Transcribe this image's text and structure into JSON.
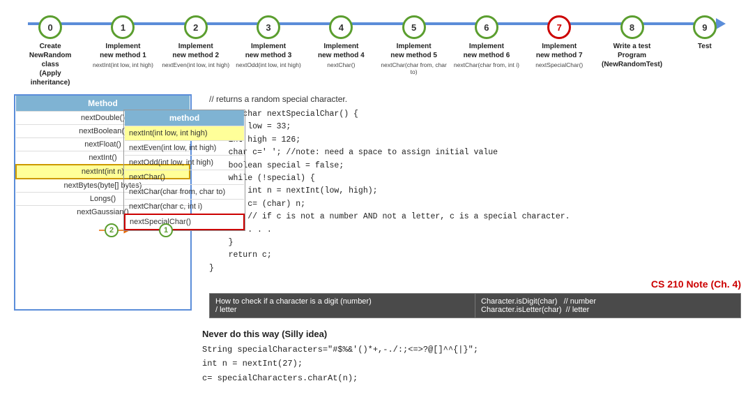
{
  "timeline": {
    "steps": [
      {
        "id": 0,
        "label": "Create\nNewRandom\nclass\n(Apply\ninheritance)",
        "sub": "",
        "border": "green"
      },
      {
        "id": 1,
        "label": "Implement\nnew method 1",
        "sub": "nextInt(int low, int high)",
        "border": "green"
      },
      {
        "id": 2,
        "label": "Implement\nnew method 2",
        "sub": "nextEven(int low, int high)",
        "border": "green"
      },
      {
        "id": 3,
        "label": "Implement\nnew method 3",
        "sub": "nextOdd(int low, int high)",
        "border": "green"
      },
      {
        "id": 4,
        "label": "Implement\nnew method 4",
        "sub": "nextChar()",
        "border": "green"
      },
      {
        "id": 5,
        "label": "Implement\nnew method 5",
        "sub": "nextChar(char from, char to)",
        "border": "green"
      },
      {
        "id": 6,
        "label": "Implement\nnew method 6",
        "sub": "nextChar(char from, int i)",
        "border": "green"
      },
      {
        "id": 7,
        "label": "Implement\nnew method 7",
        "sub": "nextSpecialChar()",
        "border": "red"
      },
      {
        "id": 8,
        "label": "Write a test\nProgram\n(NewRandomTest)",
        "sub": "",
        "border": "green"
      },
      {
        "id": 9,
        "label": "Test",
        "sub": "",
        "border": "green"
      }
    ]
  },
  "class_diagram": {
    "title": "Method",
    "methods": [
      "nextDouble()",
      "nextBoolean()",
      "nextFloat()",
      "nextInt()",
      "nextInt(int n)",
      "nextBytes(byte[] bytes)",
      "Longs()",
      "nextGaussian()"
    ]
  },
  "method_table": {
    "title": "method",
    "methods": [
      {
        "name": "nextInt(int low, int high)",
        "highlight": "yellow"
      },
      {
        "name": "nextEven(int low, int high)",
        "highlight": ""
      },
      {
        "name": "nextOdd(int low, int high)",
        "highlight": ""
      },
      {
        "name": "nextChar()",
        "highlight": ""
      },
      {
        "name": "nextChar(char from, char to)",
        "highlight": ""
      },
      {
        "name": "nextChar(char c, int i)",
        "highlight": ""
      },
      {
        "name": "nextSpecialChar()",
        "highlight": "red"
      }
    ]
  },
  "code": {
    "comment": "// returns a random special character.",
    "body": "public char nextSpecialChar() {\n    int low = 33;\n    int high = 126;\n    char c=' '; //note: need a space to assign initial value\n    boolean special = false;\n    while (!special) {\n        int n = nextInt(low, high);\n        c= (char) n;\n        // if c is not a number AND not a letter, c is a special character.\n        . . .\n    }\n    return c;\n}",
    "cs_note": "CS 210 Note (Ch. 4)",
    "info_table": [
      {
        "col1": "How to check if a character is a digit (number)\n/ letter",
        "col2": "Character.isDigit(char)  // number\nCharacter.isLetter(char)  // letter"
      }
    ]
  },
  "bottom": {
    "title": "Never do this way (Silly idea)",
    "code": "String specialCharacters=\"#$%&'()*+,-./:;<=>?@[]^^{|}\";\nint n = nextInt(27);\nc= specialCharacters.charAt(n);"
  },
  "badges": {
    "badge1": "1",
    "badge2": "2"
  }
}
